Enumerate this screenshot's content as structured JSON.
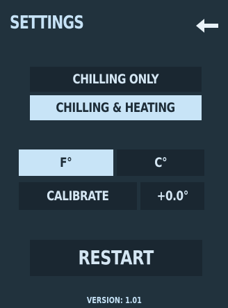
{
  "header": {
    "title": "SETTINGS",
    "back_icon": "arrow-left-icon"
  },
  "mode": {
    "options": [
      "CHILLING ONLY",
      "CHILLING & HEATING"
    ],
    "selected": "CHILLING & HEATING"
  },
  "units": {
    "options": [
      "F°",
      "C°"
    ],
    "selected": "F°"
  },
  "calibrate": {
    "label": "CALIBRATE",
    "value": "+0.0°"
  },
  "restart_label": "RESTART",
  "version": "VERSION: 1.01",
  "colors": {
    "background": "#21323d",
    "button_dark": "#1a2731",
    "button_selected": "#c8e4f7",
    "text_light": "#c6e2f6",
    "text_dark": "#1d2c37"
  }
}
